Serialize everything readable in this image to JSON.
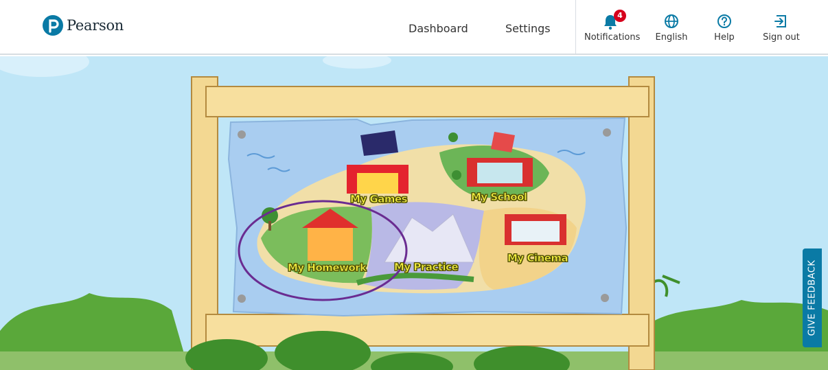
{
  "brand": {
    "name": "Pearson"
  },
  "nav": {
    "dashboard": "Dashboard",
    "settings": "Settings"
  },
  "utilities": {
    "notifications": {
      "label": "Notifications",
      "count": "4"
    },
    "language": {
      "label": "English"
    },
    "help": {
      "label": "Help"
    },
    "signout": {
      "label": "Sign out"
    }
  },
  "map": {
    "games": "My Games",
    "school": "My School",
    "homework": "My Homework",
    "practice": "My Practice",
    "cinema": "My Cinema"
  },
  "feedback": {
    "label": "GIVE FEEDBACK"
  },
  "colors": {
    "brand": "#0a7aa5",
    "highlight_circle": "#6a2c91",
    "badge": "#d6001c",
    "label_text": "#f4ef3c"
  }
}
